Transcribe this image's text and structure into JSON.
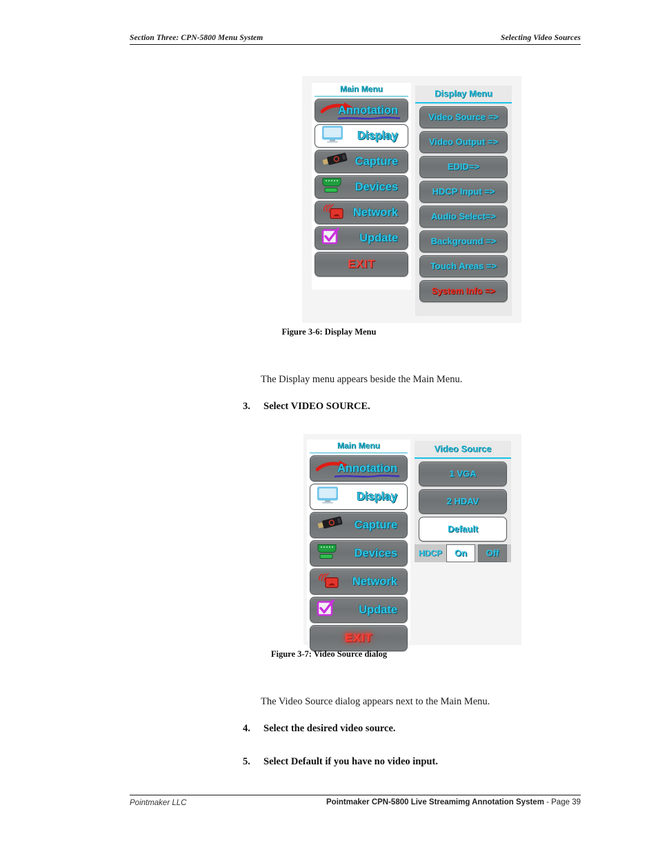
{
  "running_head": {
    "left": "Section Three: CPN-5800 Menu System",
    "right": "Selecting Video Sources"
  },
  "footer": {
    "left": "Pointmaker LLC",
    "right_bold": "Pointmaker CPN-5800 Live Streamimg Annotation System",
    "right_page": " - Page 39"
  },
  "figure1": {
    "caption": "Figure 3-6:  Display Menu",
    "main_menu": {
      "title": "Main Menu",
      "items": [
        {
          "label": "Annotation",
          "icon": "red-arrow-icon",
          "selected": false
        },
        {
          "label": "Display",
          "icon": "monitor-icon",
          "selected": true
        },
        {
          "label": "Capture",
          "icon": "usb-drive-icon",
          "selected": false
        },
        {
          "label": "Devices",
          "icon": "serial-connector-icon",
          "selected": false
        },
        {
          "label": "Network",
          "icon": "wifi-antenna-icon",
          "selected": false
        },
        {
          "label": "Update",
          "icon": "checkbox-icon",
          "selected": false
        },
        {
          "label": "EXIT",
          "icon": "none",
          "selected": false
        }
      ]
    },
    "right_panel": {
      "title": "Display Menu",
      "items": [
        {
          "label": "Video Source =>",
          "style": "normal"
        },
        {
          "label": "Video Output =>",
          "style": "normal"
        },
        {
          "label": "EDID=>",
          "style": "normal"
        },
        {
          "label": "HDCP Input =>",
          "style": "normal"
        },
        {
          "label": "Audio Select=>",
          "style": "normal"
        },
        {
          "label": "Background =>",
          "style": "normal"
        },
        {
          "label": "Touch Areas =>",
          "style": "normal"
        },
        {
          "label": "System Info =>",
          "style": "red"
        }
      ]
    }
  },
  "figure2": {
    "caption": "Figure 3-7:  Video Source dialog",
    "main_menu": {
      "title": "Main Menu",
      "items": [
        {
          "label": "Annotation",
          "icon": "red-arrow-icon",
          "selected": false
        },
        {
          "label": "Display",
          "icon": "monitor-icon",
          "selected": true
        },
        {
          "label": "Capture",
          "icon": "usb-drive-icon",
          "selected": false
        },
        {
          "label": "Devices",
          "icon": "serial-connector-icon",
          "selected": false
        },
        {
          "label": "Network",
          "icon": "wifi-antenna-icon",
          "selected": false
        },
        {
          "label": "Update",
          "icon": "checkbox-icon",
          "selected": false
        },
        {
          "label": "EXIT",
          "icon": "none",
          "selected": false
        }
      ]
    },
    "right_panel": {
      "title": "Video Source",
      "items": [
        {
          "label": "1 VGA",
          "style": "normal"
        },
        {
          "label": "2 HDAV",
          "style": "normal"
        },
        {
          "label": "Default",
          "style": "white"
        }
      ],
      "hdcp": {
        "label": "HDCP",
        "on_label": "On",
        "off_label": "Off",
        "selected": "On"
      }
    }
  },
  "body": {
    "para1": "The Display menu appears beside the Main Menu.",
    "step3": {
      "num": "3.",
      "text": "Select VIDEO SOURCE."
    },
    "para2": "The Video Source dialog appears next to the Main Menu.",
    "step4": {
      "num": "4.",
      "text": "Select the desired video source."
    },
    "step5": {
      "num": "5.",
      "text": "Select Default if you have no video input."
    }
  },
  "colors": {
    "cyan_label": "#2fc6e8",
    "red_label": "#ef2d22",
    "button_gray": "#737779",
    "panel_gray": "#e9e9e9",
    "figure_bg": "#f4f4f4"
  }
}
